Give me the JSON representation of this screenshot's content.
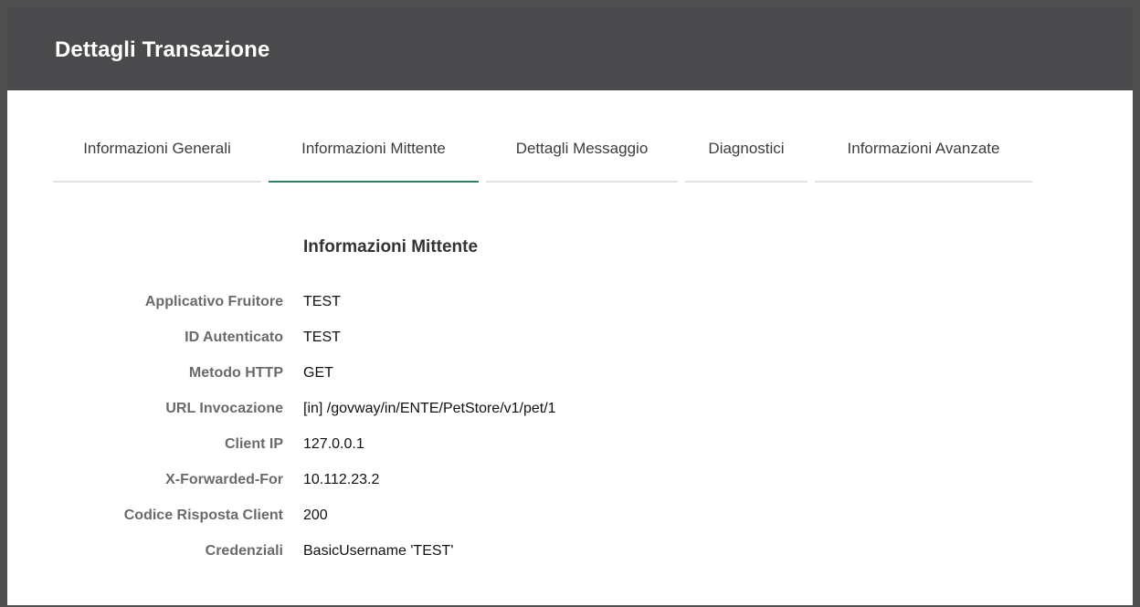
{
  "header": {
    "title": "Dettagli Transazione"
  },
  "tabs": [
    {
      "label": "Informazioni Generali",
      "active": false
    },
    {
      "label": "Informazioni Mittente",
      "active": true
    },
    {
      "label": "Dettagli Messaggio",
      "active": false
    },
    {
      "label": "Diagnostici",
      "active": false
    },
    {
      "label": "Informazioni Avanzate",
      "active": false
    }
  ],
  "section": {
    "title": "Informazioni Mittente",
    "fields": [
      {
        "label": "Applicativo Fruitore",
        "value": "TEST"
      },
      {
        "label": "ID Autenticato",
        "value": "TEST"
      },
      {
        "label": "Metodo HTTP",
        "value": "GET"
      },
      {
        "label": "URL Invocazione",
        "value": "[in] /govway/in/ENTE/PetStore/v1/pet/1"
      },
      {
        "label": "Client IP",
        "value": "127.0.0.1"
      },
      {
        "label": "X-Forwarded-For",
        "value": "10.112.23.2"
      },
      {
        "label": "Codice Risposta Client",
        "value": "200"
      },
      {
        "label": "Credenziali",
        "value": "BasicUsername 'TEST'"
      }
    ]
  },
  "colors": {
    "header_bg": "#4a4a4d",
    "active_tab_accent": "#1c8a6a",
    "label_text": "#6a6a6a"
  }
}
